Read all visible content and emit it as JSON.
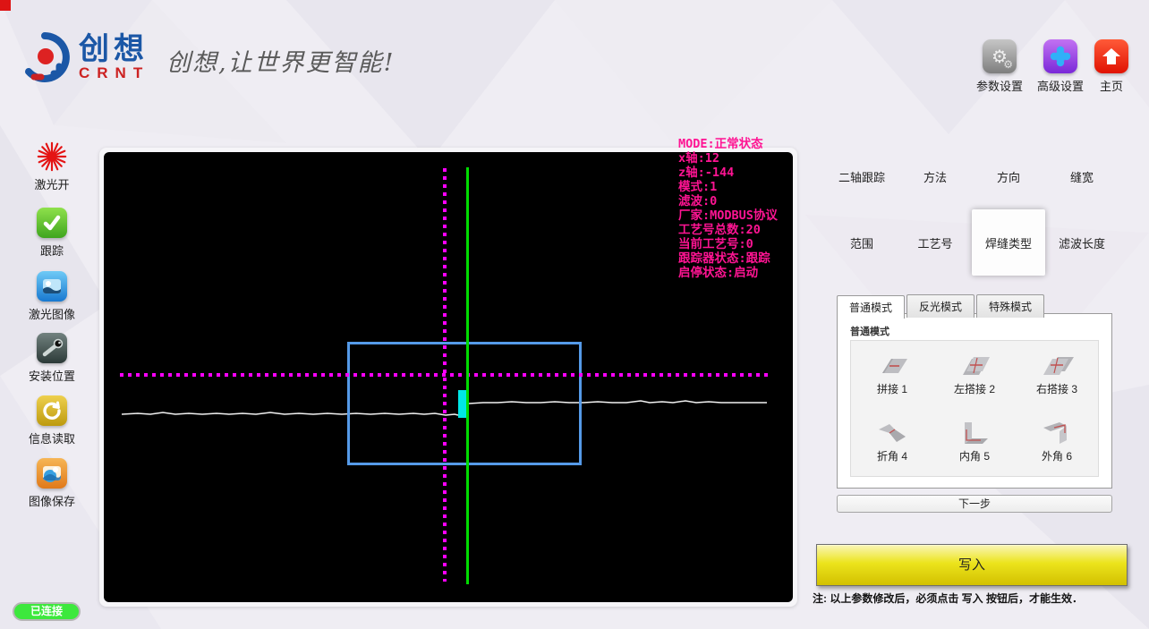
{
  "header": {
    "brand_cn": "创想",
    "brand_en": "CRNT",
    "slogan": "创想,让世界更智能!",
    "actions": [
      {
        "label": "参数设置",
        "icon": "gears-icon"
      },
      {
        "label": "高级设置",
        "icon": "puzzle-icon"
      },
      {
        "label": "主页",
        "icon": "home-icon"
      }
    ]
  },
  "sidebar": {
    "items": [
      {
        "label": "激光开",
        "icon": "laser-burst-icon"
      },
      {
        "label": "跟踪",
        "icon": "check-icon"
      },
      {
        "label": "激光图像",
        "icon": "laser-image-icon"
      },
      {
        "label": "安装位置",
        "icon": "install-position-icon"
      },
      {
        "label": "信息读取",
        "icon": "info-read-icon"
      },
      {
        "label": "图像保存",
        "icon": "image-save-icon"
      }
    ]
  },
  "canvas": {
    "overlay_lines": [
      "MODE:正常状态",
      "x轴:12",
      "z轴:-144",
      "模式:1",
      "滤波:0",
      "厂家:MODBUS协议",
      "工艺号总数:20",
      "当前工艺号:0",
      "跟踪器状态:跟踪",
      "启停状态:启动"
    ],
    "colors": {
      "overlay_text": "#ff1493",
      "crosshair": "#ff00ff",
      "reference_line": "#00dc00",
      "roi_box": "#559ae8",
      "profile_line": "#f2f2f2",
      "seam_marker": "#00e6e6",
      "background": "#000000"
    }
  },
  "nav": {
    "items": [
      {
        "label": "二轴跟踪"
      },
      {
        "label": "方法"
      },
      {
        "label": "方向"
      },
      {
        "label": "缝宽"
      },
      {
        "label": "范围"
      },
      {
        "label": "工艺号"
      },
      {
        "label": "焊缝类型"
      },
      {
        "label": "滤波长度"
      }
    ],
    "selected_label": "焊缝类型"
  },
  "weld_type_panel": {
    "tabs": [
      {
        "label": "普通模式"
      },
      {
        "label": "反光模式"
      },
      {
        "label": "特殊模式"
      }
    ],
    "active_tab": "普通模式",
    "group_label": "普通模式",
    "options": [
      {
        "label": "拼接 1",
        "icon": "butt-joint-icon"
      },
      {
        "label": "左搭接 2",
        "icon": "left-lap-joint-icon"
      },
      {
        "label": "右搭接 3",
        "icon": "right-lap-joint-icon"
      },
      {
        "label": "折角 4",
        "icon": "fold-angle-icon"
      },
      {
        "label": "内角 5",
        "icon": "inner-corner-icon"
      },
      {
        "label": "外角 6",
        "icon": "outer-corner-icon"
      }
    ]
  },
  "buttons": {
    "next": "下一步",
    "write": "写入"
  },
  "note": "注: 以上参数修改后，必须点击 写入 按钮后，才能生效．",
  "status": {
    "connected": "已连接",
    "connected_color": "#3de83d"
  },
  "accent_colors": {
    "write_button": "#e8e000",
    "brand_blue": "#1b57a6",
    "brand_red": "#cc2222"
  }
}
